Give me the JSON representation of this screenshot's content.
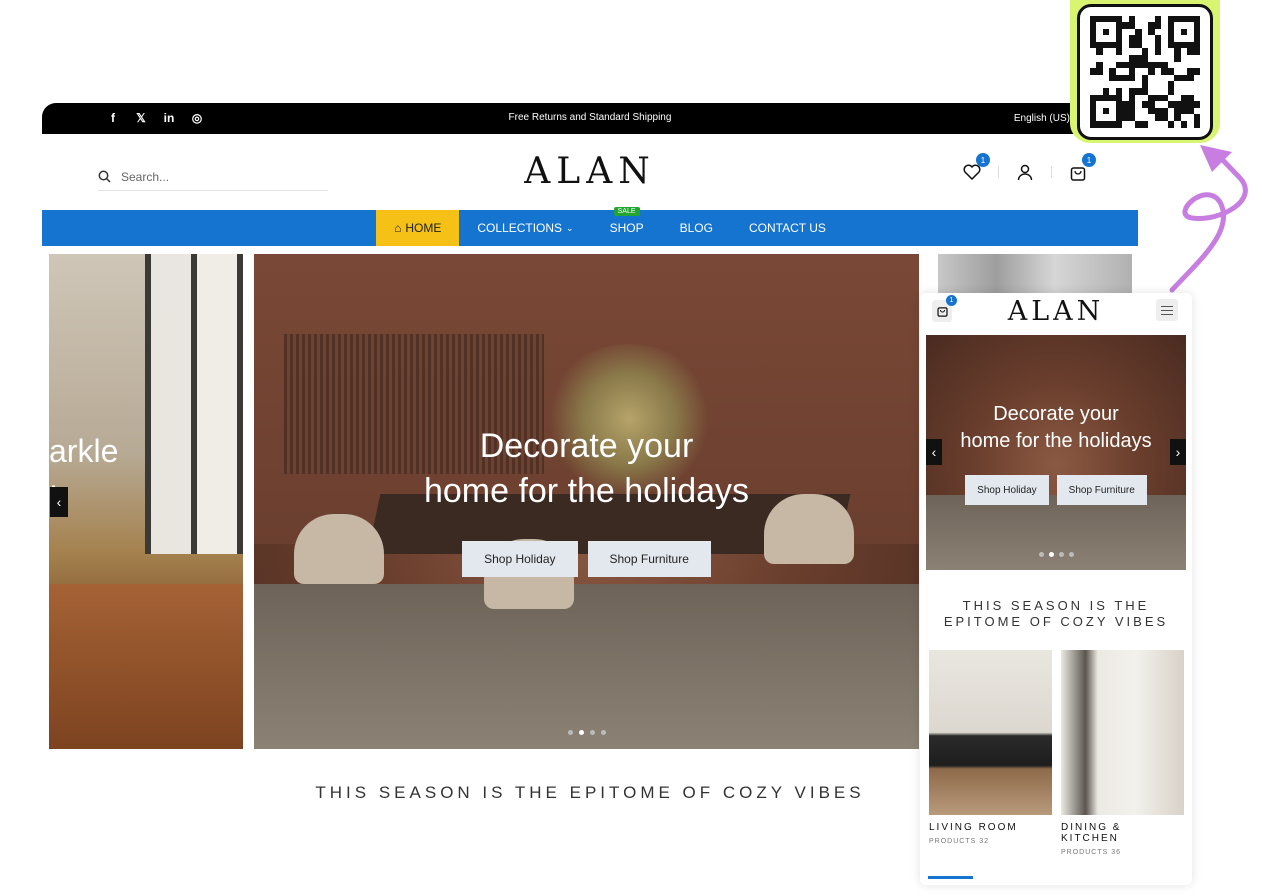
{
  "desktop": {
    "topbar": {
      "social": [
        "f",
        "𝕏",
        "in",
        "◎"
      ],
      "social_names": [
        "facebook-icon",
        "twitter-icon",
        "linkedin-icon",
        "instagram-icon"
      ],
      "announcement": "Free Returns and Standard Shipping",
      "language": "English (US)"
    },
    "header": {
      "search_placeholder": "Search...",
      "logo": "ALAN",
      "wishlist_count": "1",
      "cart_count": "1"
    },
    "nav": {
      "items": [
        {
          "label": "HOME",
          "active": true
        },
        {
          "label": "COLLECTIONS"
        },
        {
          "label": "SHOP",
          "badge": "SALE"
        },
        {
          "label": "BLOG"
        },
        {
          "label": "CONTACT US"
        }
      ]
    },
    "hero": {
      "left_partial_text": "arkle\n!",
      "title_line1": "Decorate your",
      "title_line2": "home for the holidays",
      "button1": "Shop Holiday",
      "button2": "Shop Furniture",
      "slide_count": 4,
      "active_slide": 1
    },
    "section_title": "THIS SEASON IS THE EPITOME OF COZY VIBES"
  },
  "mobile": {
    "logo": "ALAN",
    "cart_count": "1",
    "hero": {
      "title_line1": "Decorate your",
      "title_line2": "home for the holidays",
      "button1": "Shop Holiday",
      "button2": "Shop Furniture"
    },
    "section_title_line1": "THIS SEASON IS THE",
    "section_title_line2": "EPITOME OF COZY VIBES",
    "categories": [
      {
        "name": "LIVING ROOM",
        "count": "PRODUCTS 32"
      },
      {
        "name": "DINING & KITCHEN",
        "count": "PRODUCTS 36"
      }
    ]
  },
  "colors": {
    "brand_blue": "#1674d1",
    "home_yellow": "#f5c116",
    "sale_green": "#22a533",
    "qr_frame": "#d9f470",
    "arrow_purple": "#c77ee0"
  }
}
